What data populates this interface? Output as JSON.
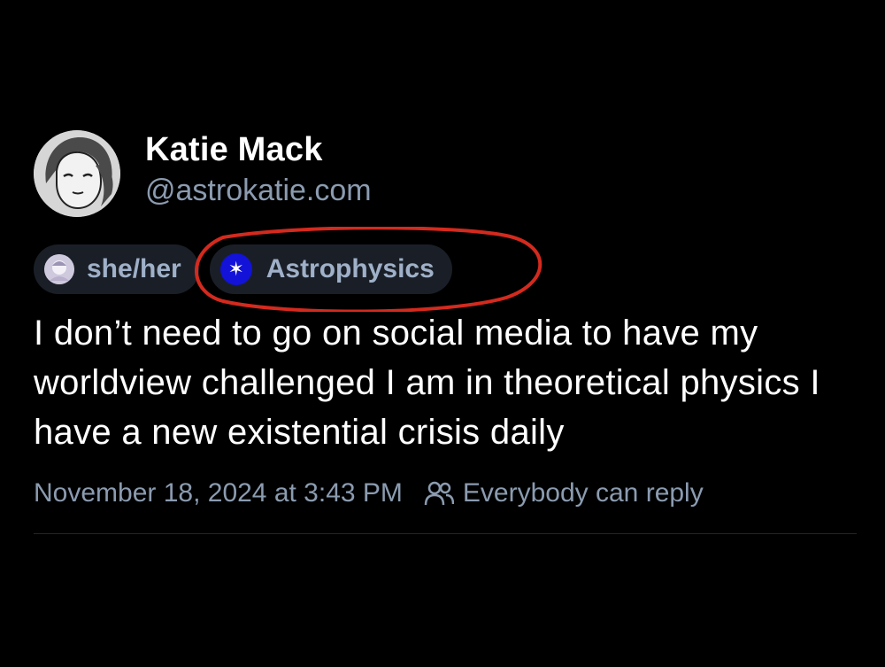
{
  "author": {
    "display_name": "Katie Mack",
    "handle": "@astrokatie.com"
  },
  "labels": [
    {
      "text": "she/her",
      "icon": "pronoun-avatar-icon"
    },
    {
      "text": "Astrophysics",
      "icon": "asterisk-icon"
    }
  ],
  "annotation": {
    "color": "#d42a1e",
    "shape": "ellipse"
  },
  "post": {
    "text": "I don’t need to go on social media to have my worldview challenged I am in theoretical physics I have a new existential crisis daily"
  },
  "meta": {
    "timestamp": "November 18, 2024 at 3:43 PM",
    "reply_setting": "Everybody can reply",
    "reply_icon": "people-icon"
  },
  "colors": {
    "background": "#000000",
    "muted_text": "#8b9bb0",
    "chip_background": "#1a1f27",
    "astrophysics_icon": "#1212d8"
  }
}
